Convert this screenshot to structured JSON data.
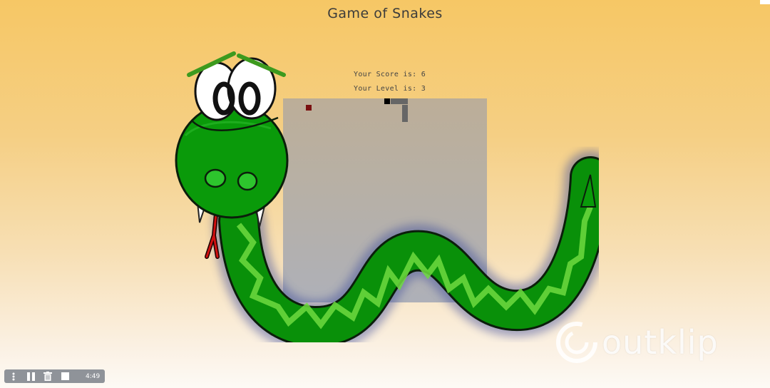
{
  "game": {
    "title": "Game of Snakes",
    "score_text": "Your Score is: 6",
    "level_text": "Your Level is: 3"
  },
  "watermark": {
    "text": "outklip"
  },
  "recorder": {
    "time": "4:49",
    "buttons": [
      "menu-icon",
      "pause-icon",
      "trash-icon",
      "stop-icon"
    ]
  },
  "colors": {
    "snake_green": "#0a9a0a",
    "snake_stripe": "#5fd33a",
    "food": "#7a1010",
    "snake_body": "#666666",
    "snake_head": "#000000"
  }
}
